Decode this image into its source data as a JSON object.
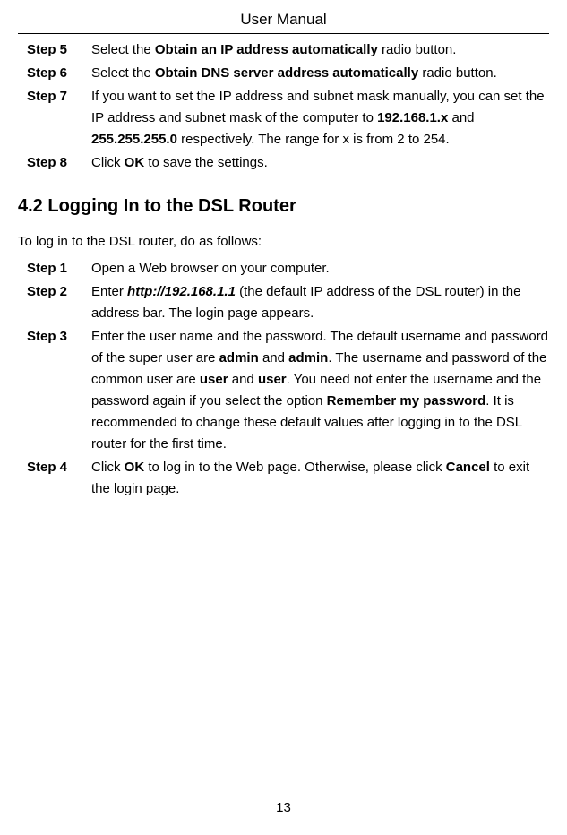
{
  "header": {
    "title": "User Manual"
  },
  "section1": {
    "steps": [
      {
        "label": "Step 5",
        "parts": [
          {
            "text": "Select the "
          },
          {
            "text": "Obtain an IP address automatically",
            "bold": true
          },
          {
            "text": " radio button."
          }
        ]
      },
      {
        "label": "Step 6",
        "parts": [
          {
            "text": "Select the "
          },
          {
            "text": "Obtain DNS server address automatically",
            "bold": true
          },
          {
            "text": " radio button."
          }
        ]
      },
      {
        "label": "Step 7",
        "parts": [
          {
            "text": "If you want to set the IP address and subnet mask manually, you can set the IP address and subnet mask of the computer to "
          },
          {
            "text": "192.168.1.x",
            "bold": true
          },
          {
            "text": " and "
          },
          {
            "text": "255.255.255.0",
            "bold": true
          },
          {
            "text": " respectively. The range for x is from 2 to 254."
          }
        ]
      },
      {
        "label": "Step 8",
        "parts": [
          {
            "text": "Click "
          },
          {
            "text": "OK",
            "bold": true
          },
          {
            "text": " to save the settings."
          }
        ]
      }
    ]
  },
  "section2": {
    "heading": "4.2   Logging In to the DSL Router",
    "intro": "To log in to the DSL router, do as follows:",
    "steps": [
      {
        "label": "Step 1",
        "parts": [
          {
            "text": "Open a Web browser on your computer."
          }
        ]
      },
      {
        "label": "Step 2",
        "parts": [
          {
            "text": "Enter "
          },
          {
            "text": "http://192.168.1.1",
            "boldItalic": true
          },
          {
            "text": " (the default IP address of the DSL router) in the address bar. The login page appears."
          }
        ]
      },
      {
        "label": "Step 3",
        "parts": [
          {
            "text": "Enter the user name and the password. The default username and password of the super user are "
          },
          {
            "text": "admin",
            "bold": true
          },
          {
            "text": " and "
          },
          {
            "text": "admin",
            "bold": true
          },
          {
            "text": ". The username and password of the common user are "
          },
          {
            "text": "user",
            "bold": true
          },
          {
            "text": " and "
          },
          {
            "text": "user",
            "bold": true
          },
          {
            "text": ". You need not enter the username and the password again if you select the option "
          },
          {
            "text": "Remember my password",
            "bold": true
          },
          {
            "text": ". It is recommended to change these default values after logging in to the DSL router for the first time."
          }
        ]
      },
      {
        "label": "Step 4",
        "parts": [
          {
            "text": "Click "
          },
          {
            "text": "OK",
            "bold": true
          },
          {
            "text": " to log in to the Web page. Otherwise, please click "
          },
          {
            "text": "Cancel",
            "bold": true
          },
          {
            "text": " to exit the login page."
          }
        ]
      }
    ]
  },
  "footer": {
    "pageNumber": "13"
  }
}
